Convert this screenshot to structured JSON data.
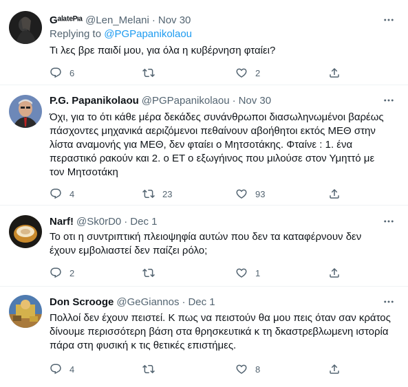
{
  "tweets": [
    {
      "name": "Gᵃˡᵃᵗᵉᴾᶦᵃ",
      "handle": "@Len_Melani",
      "sep": "·",
      "date": "Nov 30",
      "replying_prefix": "Replying to ",
      "replying_to": "@PGPapanikolaou",
      "text": "Τι λες βρε παιδί μου, για όλα η κυβέρνηση φταίει?",
      "replies": "6",
      "retweets": "",
      "likes": "2"
    },
    {
      "name": "P.G. Papanikolaou",
      "handle": "@PGPapanikolaou",
      "sep": "·",
      "date": "Nov 30",
      "text_lines": [
        "Όχι, για το ότι κάθε μέρα δεκάδες συνάνθρωποι διασωληνωμένοι βαρέως",
        "πάσχοντες μηχανικά αεριζόμενοι πεθαίνουν αβοήθητοι εκτός ΜΕΘ στην",
        "λίστα αναμονής για ΜΕΘ, δεν φταίει ο Μητσοτάκης. Φταίνε : 1. ένα",
        "περαστικό ρακούν και 2. ο ΕΤ ο εξωγήινος που μιλούσε στον Υμηττό με",
        "τον Μητσοτάκη"
      ],
      "replies": "4",
      "retweets": "23",
      "likes": "93"
    },
    {
      "name": "Narf!",
      "handle": "@Sk0rD0",
      "sep": "·",
      "date": "Dec 1",
      "text_lines": [
        "Το οτι η συντριπτική πλειοψηφία αυτών που δεν τα καταφέρνουν δεν",
        "έχουν εμβολιαστεί δεν παίζει ρόλο;"
      ],
      "replies": "2",
      "retweets": "",
      "likes": "1"
    },
    {
      "name": "Don Scrooge",
      "handle": "@GeGiannos",
      "sep": "·",
      "date": "Dec 1",
      "text_lines": [
        "Πολλοί δεν έχουν πειστεί. Κ πως να πειστούν θα μου πεις όταν σαν κράτος",
        "δίνουμε περισσότερη βάση στα θρησκευτικά κ τη δκαστρεβλωμενη ιστορία",
        "πάρα στη φυσική κ τις θετικές επιστήμες."
      ],
      "replies": "4",
      "retweets": "",
      "likes": "8"
    }
  ],
  "icons": {
    "reply": "reply-icon",
    "retweet": "retweet-icon",
    "like": "heart-icon",
    "share": "share-icon",
    "more": "more-icon"
  },
  "colors": {
    "text": "#0f1419",
    "secondary": "#536471",
    "link": "#1d9bf0",
    "divider": "#eff3f4"
  }
}
